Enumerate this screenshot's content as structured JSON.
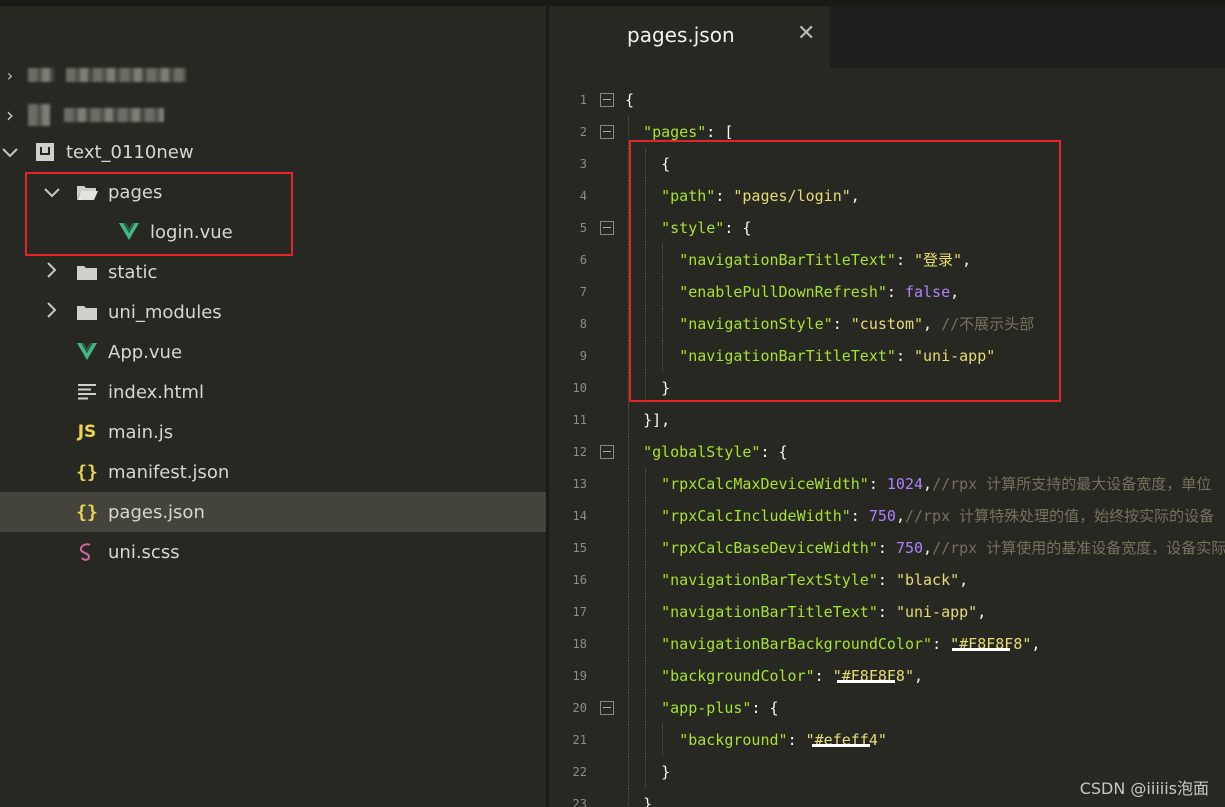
{
  "sidebar": {
    "items": [
      {
        "label": "text_0110new",
        "chevron": "v",
        "icon": "project-icon"
      },
      {
        "label": "pages",
        "chevron": "v",
        "icon": "folder-open-icon"
      },
      {
        "label": "login.vue",
        "chevron": "",
        "icon": "vue-icon"
      },
      {
        "label": "static",
        "chevron": ">",
        "icon": "folder-icon"
      },
      {
        "label": "uni_modules",
        "chevron": ">",
        "icon": "folder-icon"
      },
      {
        "label": "App.vue",
        "chevron": "",
        "icon": "vue-icon"
      },
      {
        "label": "index.html",
        "chevron": "",
        "icon": "html-lines-icon"
      },
      {
        "label": "main.js",
        "chevron": "",
        "icon": "js-icon"
      },
      {
        "label": "manifest.json",
        "chevron": "",
        "icon": "json-braces-icon"
      },
      {
        "label": "pages.json",
        "chevron": "",
        "icon": "json-braces-icon",
        "selected": true
      },
      {
        "label": "uni.scss",
        "chevron": "",
        "icon": "sass-icon"
      }
    ],
    "icons": {
      "vue_color": "#42b883",
      "js_color": "#e8d44d",
      "json_color": "#e8d44d",
      "sass_color": "#cd6799"
    }
  },
  "editor": {
    "tab": {
      "label": "pages.json",
      "close_icon": "close-icon"
    },
    "lines": [
      {
        "n": "1",
        "text": "{"
      },
      {
        "n": "2",
        "text": "  \"pages\": ["
      },
      {
        "n": "3",
        "text": "    {"
      },
      {
        "n": "4",
        "text": "    \"path\": \"pages/login\","
      },
      {
        "n": "5",
        "text": "    \"style\": {"
      },
      {
        "n": "6",
        "text": "      \"navigationBarTitleText\": \"登录\","
      },
      {
        "n": "7",
        "text": "      \"enablePullDownRefresh\": false,"
      },
      {
        "n": "8",
        "text": "      \"navigationStyle\": \"custom\", //不展示头部"
      },
      {
        "n": "9",
        "text": "      \"navigationBarTitleText\": \"uni-app\""
      },
      {
        "n": "10",
        "text": "    }"
      },
      {
        "n": "11",
        "text": "  }],"
      },
      {
        "n": "12",
        "text": "  \"globalStyle\": {"
      },
      {
        "n": "13",
        "text": "    \"rpxCalcMaxDeviceWidth\": 1024,//rpx 计算所支持的最大设备宽度，单位"
      },
      {
        "n": "14",
        "text": "    \"rpxCalcIncludeWidth\": 750,//rpx 计算特殊处理的值，始终按实际的设备"
      },
      {
        "n": "15",
        "text": "    \"rpxCalcBaseDeviceWidth\": 750,//rpx 计算使用的基准设备宽度，设备实际"
      },
      {
        "n": "16",
        "text": "    \"navigationBarTextStyle\": \"black\","
      },
      {
        "n": "17",
        "text": "    \"navigationBarTitleText\": \"uni-app\","
      },
      {
        "n": "18",
        "text": "    \"navigationBarBackgroundColor\": \"#F8F8F8\","
      },
      {
        "n": "19",
        "text": "    \"backgroundColor\": \"#F8F8F8\","
      },
      {
        "n": "20",
        "text": "    \"app-plus\": {"
      },
      {
        "n": "21",
        "text": "      \"background\": \"#efeff4\""
      },
      {
        "n": "22",
        "text": "    }"
      },
      {
        "n": "23",
        "text": "  }"
      }
    ]
  },
  "colors": {
    "highlight_box": "#e0262b",
    "key": "#a6e22e",
    "string": "#e6db74",
    "number": "#ae81ff",
    "comment": "#75715e"
  },
  "watermark": "CSDN @iiiiis泡面"
}
